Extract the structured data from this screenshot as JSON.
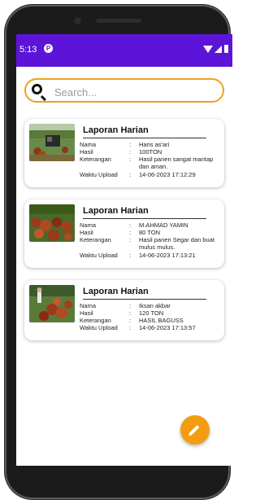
{
  "status_bar": {
    "time": "5:13",
    "app_icon": "P"
  },
  "search": {
    "placeholder": "Search..."
  },
  "labels": {
    "nama": "Nama",
    "hasil": "Hasil",
    "keterangan": "Keterangan",
    "waktu_upload": "Waktu Upload",
    "separator": ":"
  },
  "reports": [
    {
      "title": "Laporan Harian",
      "nama": "Haris as'ari",
      "hasil": "100TON",
      "keterangan": "Hasil panen sangat mantap dan aman.",
      "waktu_upload": "14-06-2023 17:12:29"
    },
    {
      "title": "Laporan Harian",
      "nama": "M.AHMAD YAMIN",
      "hasil": "80 TON",
      "keterangan": "Hasil panen Segar dan buat mulus mulus.",
      "waktu_upload": "14-06-2023 17:13:21"
    },
    {
      "title": "Laporan Harian",
      "nama": "Iksan akbar",
      "hasil": "120 TON",
      "keterangan": "HASIL BAGUSS",
      "waktu_upload": "14-06-2023 17:13:57"
    }
  ],
  "icons": {
    "search": "search-icon",
    "fab": "pencil-icon",
    "nav": [
      "back-icon",
      "home-icon",
      "recents-icon"
    ]
  },
  "colors": {
    "status_bar": "#5c15d8",
    "accent": "#f39c12",
    "search_border": "#f0a020"
  }
}
